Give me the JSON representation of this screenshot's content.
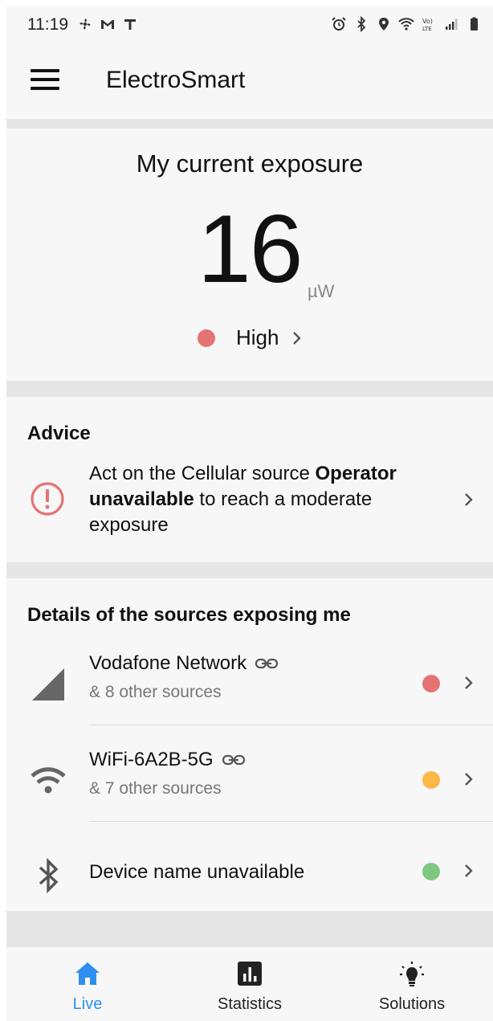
{
  "status_bar": {
    "time": "11:19",
    "left_icons": [
      "fan-icon",
      "gmail-icon",
      "t-icon"
    ],
    "right_icons": [
      "alarm-icon",
      "bluetooth-icon",
      "location-icon",
      "wifi-icon",
      "volte-icon",
      "signal-icon",
      "battery-icon"
    ]
  },
  "app_bar": {
    "title": "ElectroSmart",
    "menu_icon": "hamburger-menu-icon"
  },
  "exposure": {
    "title": "My current exposure",
    "value": "16",
    "unit": "µW",
    "level_label": "High",
    "level_color": "#e57373"
  },
  "advice": {
    "title": "Advice",
    "text_prefix": "Act on the Cellular source ",
    "text_bold": "Operator unavailable",
    "text_suffix": " to reach a moderate exposure",
    "icon": "alert-circle-icon",
    "icon_color": "#e57373"
  },
  "details": {
    "title": "Details of the sources exposing me",
    "sources": [
      {
        "name": "Vodafone Network",
        "sub": "& 8 other sources",
        "icon": "cellular-signal-icon",
        "status_color": "#e57373"
      },
      {
        "name": "WiFi-6A2B-5G",
        "sub": "& 7 other sources",
        "icon": "wifi-icon",
        "status_color": "#fbb849"
      },
      {
        "name": "Device name unavailable",
        "sub": "",
        "icon": "bluetooth-icon",
        "status_color": "#81c784"
      }
    ]
  },
  "bottom_nav": {
    "items": [
      {
        "label": "Live",
        "icon": "home-icon",
        "active": true
      },
      {
        "label": "Statistics",
        "icon": "bar-chart-icon",
        "active": false
      },
      {
        "label": "Solutions",
        "icon": "lightbulb-icon",
        "active": false
      }
    ],
    "active_color": "#2f8ff0"
  }
}
